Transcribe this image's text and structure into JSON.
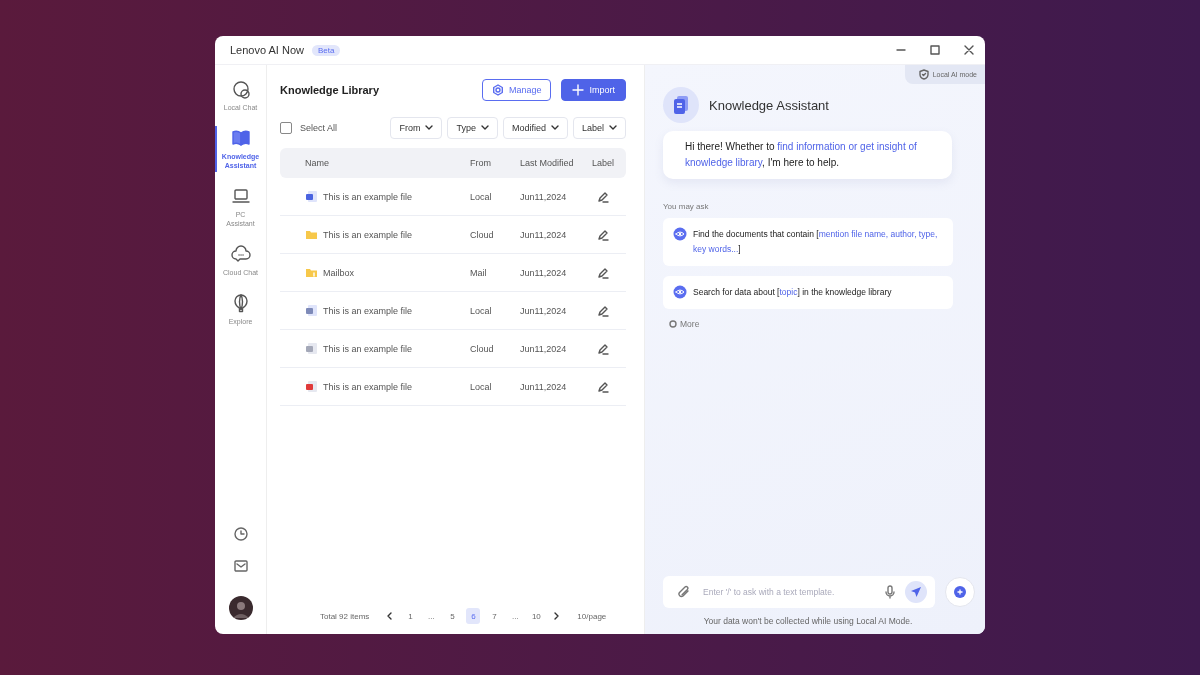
{
  "window": {
    "title": "Lenovo AI Now",
    "badge": "Beta"
  },
  "nav": [
    {
      "label": "Local Chat",
      "selected": false
    },
    {
      "label": "Knowledge Assistant",
      "selected": true
    },
    {
      "label": "PC Assistant",
      "selected": false
    },
    {
      "label": "Cloud Chat",
      "selected": false
    },
    {
      "label": "Explore",
      "selected": false
    }
  ],
  "library": {
    "title": "Knowledge Library",
    "manage": "Manage",
    "import": "Import",
    "select_all": {
      "label": "Select All",
      "checked": false
    },
    "filters": [
      "From",
      "Type",
      "Modified",
      "Label"
    ],
    "columns": [
      "Name",
      "From",
      "Last Modified",
      "Label"
    ],
    "rows": [
      {
        "kind": "word",
        "name": "This is an example file",
        "from": "Local",
        "modified": "Jun11,2024"
      },
      {
        "kind": "folder",
        "name": "This is an example file",
        "from": "Cloud",
        "modified": "Jun11,2024"
      },
      {
        "kind": "mailbox",
        "name": "Mailbox",
        "from": "Mail",
        "modified": "Jun11,2024"
      },
      {
        "kind": "doc",
        "name": "This is an example file",
        "from": "Local",
        "modified": "Jun11,2024"
      },
      {
        "kind": "text",
        "name": "This is an example file",
        "from": "Cloud",
        "modified": "Jun11,2024"
      },
      {
        "kind": "pdf",
        "name": "This is an example file",
        "from": "Local",
        "modified": "Jun11,2024"
      }
    ],
    "pagination": {
      "total": "Total 92 items",
      "pages": [
        {
          "label": "1",
          "selected": false
        },
        {
          "label": "...",
          "selected": false
        },
        {
          "label": "5",
          "selected": false
        },
        {
          "label": "6",
          "selected": true
        },
        {
          "label": "7",
          "selected": false
        },
        {
          "label": "...",
          "selected": false
        },
        {
          "label": "10",
          "selected": false
        }
      ],
      "per_page": "10/page"
    }
  },
  "assistant": {
    "mode": "Local AI mode",
    "title": "Knowledge Assistant",
    "greeting": [
      {
        "text": "Hi there! Whether to ",
        "highlight": false
      },
      {
        "text": "find information or get insight of knowledge library",
        "highlight": true
      },
      {
        "text": ", I'm here to help.",
        "highlight": false
      }
    ],
    "you_may_ask": "You may ask",
    "suggestions": [
      [
        {
          "text": "Find the documents that contain [",
          "highlight": false
        },
        {
          "text": "mention file name, author, type, key words...",
          "highlight": true
        },
        {
          "text": "]",
          "highlight": false
        }
      ],
      [
        {
          "text": "Search for data about [",
          "highlight": false
        },
        {
          "text": "topic",
          "highlight": true
        },
        {
          "text": "] in the knowledge library",
          "highlight": false
        }
      ]
    ],
    "more": "More",
    "input": {
      "placeholder": "Enter '/' to ask with a text template."
    },
    "footer": "Your data won't be collected while using  Local AI Mode."
  }
}
